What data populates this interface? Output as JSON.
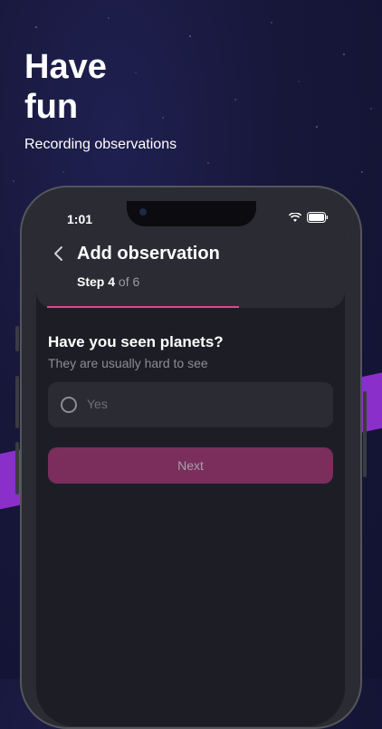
{
  "promo": {
    "title": "Have fun",
    "subtitle": "Recording observations"
  },
  "status_bar": {
    "time": "1:01"
  },
  "header": {
    "title": "Add observation",
    "step_current_label": "Step 4",
    "step_total_label": "of 6"
  },
  "progress": {
    "fraction": 0.67,
    "color": "#e0468f"
  },
  "question": {
    "title": "Have you seen planets?",
    "hint": "They are usually hard to see"
  },
  "options": [
    {
      "label": "Yes",
      "selected": false
    }
  ],
  "next_button": {
    "label": "Next",
    "color": "#7b2d5c"
  },
  "icons": [
    "back-chevron-icon",
    "wifi-icon",
    "battery-icon",
    "radio-icon"
  ]
}
